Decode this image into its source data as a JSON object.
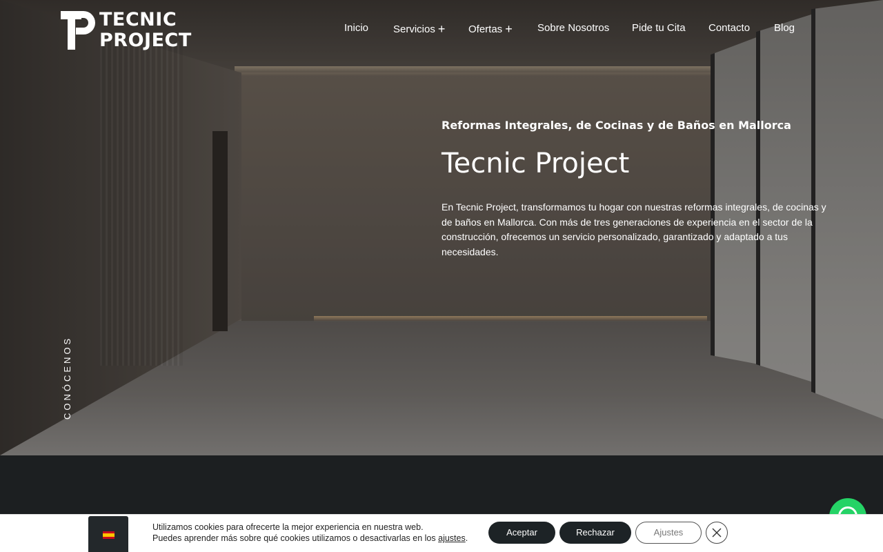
{
  "brand": {
    "line1": "TECNIC",
    "line2": "PROJECT"
  },
  "nav": {
    "items": [
      {
        "label": "Inicio",
        "has_submenu": false
      },
      {
        "label": "Servicios",
        "has_submenu": true
      },
      {
        "label": "Ofertas",
        "has_submenu": true
      },
      {
        "label": "Sobre Nosotros",
        "has_submenu": false
      },
      {
        "label": "Pide tu Cita",
        "has_submenu": false
      },
      {
        "label": "Contacto",
        "has_submenu": false
      },
      {
        "label": "Blog",
        "has_submenu": false
      }
    ],
    "submenu_symbol": "+"
  },
  "hero": {
    "subtitle": "Reformas Integrales, de Cocinas y de Baños en Mallorca",
    "title": "Tecnic Project",
    "description": "En Tecnic Project, transformamos tu hogar con nuestras reformas integrales, de cocinas y de baños en Mallorca. Con más de tres generaciones de experiencia en el sector de la construcción, ofrecemos un servicio personalizado, garantizado y adaptado a tus necesidades.",
    "side_link": "CONÓCENOS"
  },
  "cookie": {
    "line1": "Utilizamos cookies para ofrecerte la mejor experiencia en nuestra web.",
    "line2_prefix": "Puedes aprender más sobre qué cookies utilizamos o desactivarlas en los ",
    "line2_link": "ajustes",
    "line2_suffix": ".",
    "accept_label": "Aceptar",
    "reject_label": "Rechazar",
    "settings_label": "Ajustes",
    "language": "es"
  },
  "icons": {
    "whatsapp": "whatsapp-icon",
    "close": "close-icon",
    "flag": "spain-flag-icon"
  },
  "colors": {
    "whatsapp": "#25d366",
    "dark_button": "#1d2326",
    "dark_section": "#1c1f21"
  }
}
